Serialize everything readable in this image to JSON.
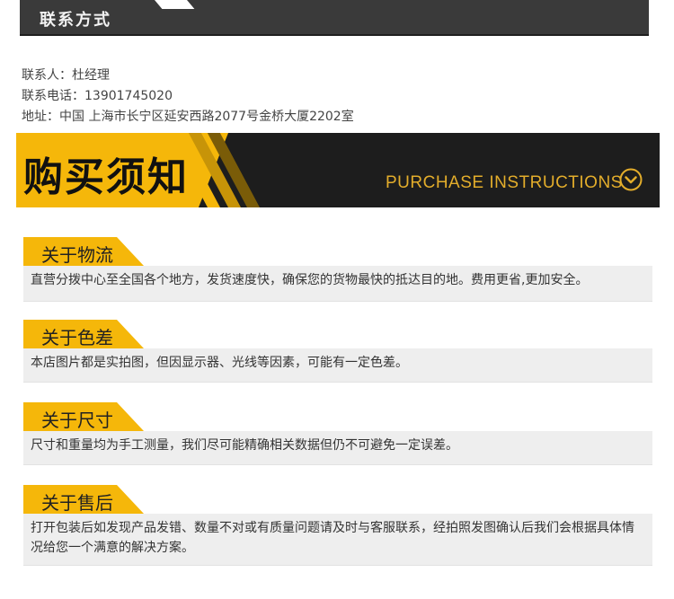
{
  "contact": {
    "header_title": "联系方式",
    "lines": [
      "联系人：杜经理",
      "联系电话：13901745020",
      "地址：中国 上海市长宁区延安西路2077号金桥大厦2202室"
    ]
  },
  "banner": {
    "title_cn": "购买须知",
    "title_en": "PURCHASE INSTRUCTIONS",
    "icon": "chevron-down-circle-icon",
    "colors": {
      "accent": "#f5b70a",
      "dark": "#1d1d1d",
      "en_text": "#e3ad2b"
    }
  },
  "sections": [
    {
      "title": "关于物流",
      "text": "直营分拨中心至全国各个地方，发货速度快，确保您的货物最快的抵达目的地。费用更省,更加安全。"
    },
    {
      "title": "关于色差",
      "text": "本店图片都是实拍图，但因显示器、光线等因素，可能有一定色差。"
    },
    {
      "title": "关于尺寸",
      "text": "尺寸和重量均为手工测量，我们尽可能精确相关数据但仍不可避免一定误差。"
    },
    {
      "title": "关于售后",
      "text": "打开包装后如发现产品发错、数量不对或有质量问题请及时与客服联系，经拍照发图确认后我们会根据具体情况给您一个满意的解决方案。"
    }
  ]
}
